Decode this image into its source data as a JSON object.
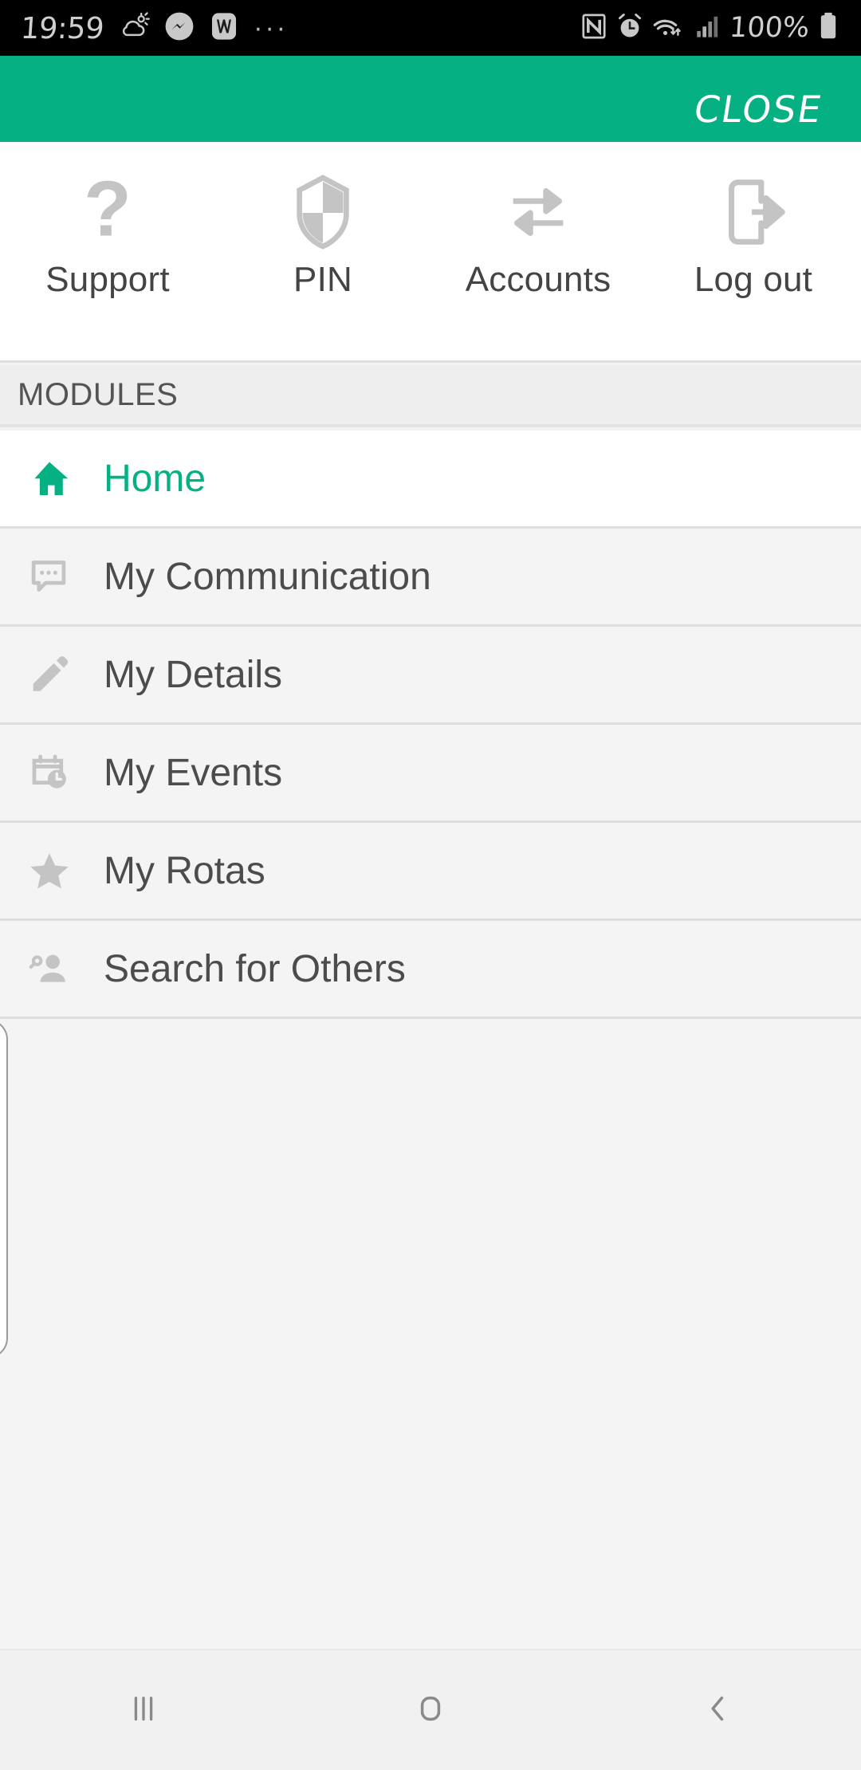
{
  "status_bar": {
    "time": "19:59",
    "left_icons": [
      "weather-partly-cloudy-icon",
      "messenger-icon",
      "wordpress-icon"
    ],
    "overflow": "···",
    "right_icons": [
      "nfc-icon",
      "alarm-icon",
      "wifi-icon",
      "signal-icon"
    ],
    "battery_percent": "100%",
    "battery_icon": "battery-full-icon"
  },
  "app_bar": {
    "close_label": "CLOSE",
    "background_color": "#05b182"
  },
  "toolbar": {
    "items": [
      {
        "label": "Support",
        "icon": "question-mark-icon"
      },
      {
        "label": "PIN",
        "icon": "shield-icon"
      },
      {
        "label": "Accounts",
        "icon": "swap-arrows-icon"
      },
      {
        "label": "Log out",
        "icon": "logout-icon"
      }
    ]
  },
  "modules": {
    "header": "MODULES",
    "items": [
      {
        "label": "Home",
        "icon": "home-icon",
        "active": true
      },
      {
        "label": "My Communication",
        "icon": "chat-bubble-icon",
        "active": false
      },
      {
        "label": "My Details",
        "icon": "pencil-icon",
        "active": false
      },
      {
        "label": "My Events",
        "icon": "calendar-clock-icon",
        "active": false
      },
      {
        "label": "My Rotas",
        "icon": "star-icon",
        "active": false
      },
      {
        "label": "Search for Others",
        "icon": "person-search-icon",
        "active": false
      }
    ]
  },
  "nav_bar": {
    "buttons": [
      {
        "name": "recents",
        "icon": "recents-icon"
      },
      {
        "name": "home",
        "icon": "home-square-icon"
      },
      {
        "name": "back",
        "icon": "back-chevron-icon"
      }
    ]
  },
  "colors": {
    "accent_green": "#05b182",
    "row_background": "#f4f4f4",
    "active_row_background": "#ffffff",
    "icon_gray": "#c4c4c4",
    "text_gray": "#4c4c4c"
  }
}
